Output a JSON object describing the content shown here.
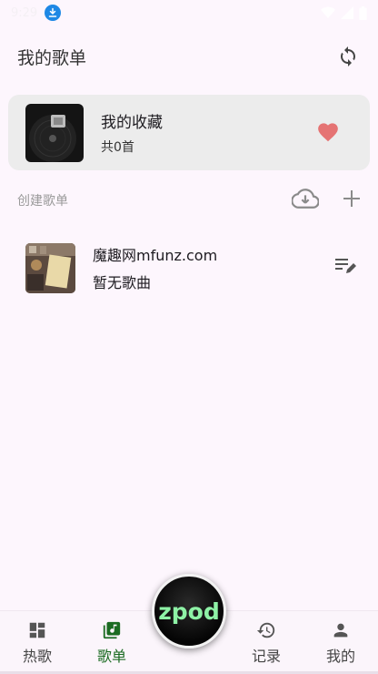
{
  "status_bar": {
    "time": "9:29"
  },
  "header": {
    "title": "我的歌单"
  },
  "favorites": {
    "title": "我的收藏",
    "count_text": "共0首"
  },
  "section": {
    "label": "创建歌单"
  },
  "playlists": [
    {
      "title": "魔趣网mfunz.com",
      "subtitle": "暂无歌曲"
    }
  ],
  "fab": {
    "label": "zpod"
  },
  "nav": [
    {
      "label": "热歌",
      "icon": "dashboard-icon"
    },
    {
      "label": "歌单",
      "icon": "music-library-icon",
      "active": true
    },
    {
      "label": "记录",
      "icon": "history-icon"
    },
    {
      "label": "我的",
      "icon": "person-icon"
    }
  ],
  "colors": {
    "background": "#fdf6fd",
    "accent": "#1b6b22",
    "heart": "#e57373",
    "fab_text": "#8ef2a6"
  }
}
